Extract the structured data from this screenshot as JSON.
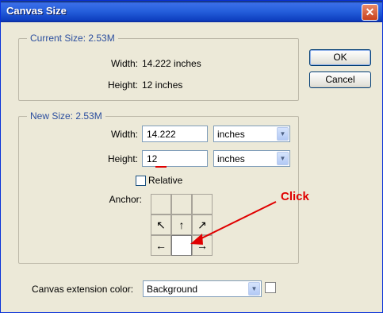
{
  "window": {
    "title": "Canvas Size",
    "close_symbol": "✕"
  },
  "current_size": {
    "legend": "Current Size: 2.53M",
    "width_label": "Width:",
    "width_value": "14.222 inches",
    "height_label": "Height:",
    "height_value": "12 inches"
  },
  "new_size": {
    "legend": "New Size: 2.53M",
    "width_label": "Width:",
    "width_value": "14.222",
    "width_unit": "inches",
    "height_label": "Height:",
    "height_value": "12",
    "height_unit": "inches",
    "relative_label": "Relative",
    "relative_checked": false,
    "anchor_label": "Anchor:",
    "anchor_arrows": [
      "",
      "",
      "",
      "↖",
      "↑",
      "↗",
      "←",
      "",
      "→"
    ],
    "anchor_selected_index": 7
  },
  "buttons": {
    "ok": "OK",
    "cancel": "Cancel"
  },
  "extension": {
    "label": "Canvas extension color:",
    "value": "Background"
  },
  "annotation": {
    "text": "Click",
    "color": "#e00000"
  }
}
